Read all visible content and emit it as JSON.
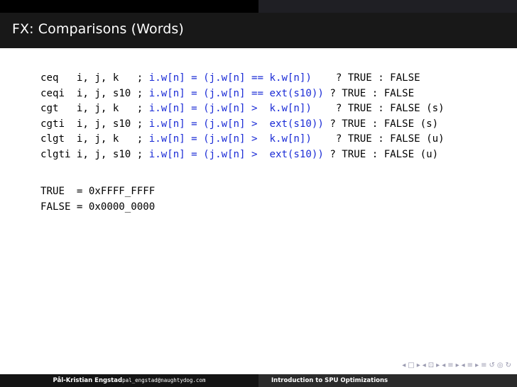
{
  "slide": {
    "title": "FX: Comparisons (Words)"
  },
  "code_lines": [
    {
      "op": "ceq  ",
      "args": " i, j, k   ",
      "sep": "; ",
      "expr": "i.w[n] = (j.w[n] == k.w[n])",
      "rest": "    ? TRUE : FALSE"
    },
    {
      "op": "ceqi ",
      "args": " i, j, s10 ",
      "sep": "; ",
      "expr": "i.w[n] = (j.w[n] == ext(s10))",
      "rest": " ? TRUE : FALSE"
    },
    {
      "op": "cgt  ",
      "args": " i, j, k   ",
      "sep": "; ",
      "expr": "i.w[n] = (j.w[n] >  k.w[n])",
      "rest": "    ? TRUE : FALSE (s)"
    },
    {
      "op": "cgti ",
      "args": " i, j, s10 ",
      "sep": "; ",
      "expr": "i.w[n] = (j.w[n] >  ext(s10))",
      "rest": " ? TRUE : FALSE (s)"
    },
    {
      "op": "clgt ",
      "args": " i, j, k   ",
      "sep": "; ",
      "expr": "i.w[n] = (j.w[n] >  k.w[n])",
      "rest": "    ? TRUE : FALSE (u)"
    },
    {
      "op": "clgti",
      "args": " i, j, s10 ",
      "sep": "; ",
      "expr": "i.w[n] = (j.w[n] >  ext(s10))",
      "rest": " ? TRUE : FALSE (u)"
    }
  ],
  "constants": [
    "TRUE  = 0xFFFF_FFFF",
    "FALSE = 0x0000_0000"
  ],
  "footer": {
    "author": "Pål-Kristian Engstad",
    "email": "pal_engstad@naughtydog.com",
    "talk_title": "Introduction to SPU Optimizations"
  },
  "nav": {
    "symbols": [
      "◂",
      "□",
      "▸",
      "◂",
      "⊡",
      "▸",
      "◂",
      "≡",
      "▸",
      "◂",
      "≡",
      "▸",
      "≡",
      "↺",
      "◎",
      "↻"
    ]
  }
}
